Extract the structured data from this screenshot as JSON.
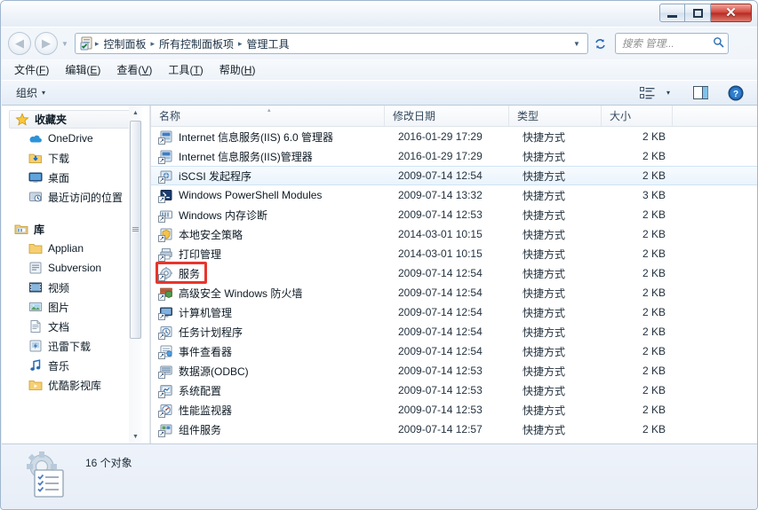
{
  "window": {
    "caption_buttons": [
      {
        "name": "minimize",
        "glyph": "minimize-icon"
      },
      {
        "name": "maximize",
        "glyph": "maximize-icon"
      },
      {
        "name": "close",
        "glyph": "close-icon",
        "label": "✕",
        "color": "#c5372c"
      }
    ]
  },
  "addressbar": {
    "back_label": "◀",
    "forward_label": "▶",
    "history_caret": "▼",
    "icon": "control-panel-icon",
    "crumbs": [
      "控制面板",
      "所有控制面板项",
      "管理工具"
    ],
    "separator": "▸",
    "dropdown_caret": "▼",
    "refresh_label": "↻"
  },
  "search": {
    "placeholder": "搜索 管理...",
    "icon_label": "⌕"
  },
  "menubar": {
    "items": [
      {
        "text": "文件",
        "key": "F"
      },
      {
        "text": "编辑",
        "key": "E"
      },
      {
        "text": "查看",
        "key": "V"
      },
      {
        "text": "工具",
        "key": "T"
      },
      {
        "text": "帮助",
        "key": "H"
      }
    ]
  },
  "commandbar": {
    "organize_label": "组织",
    "organize_caret": "▾",
    "view_icon": "view-options-icon",
    "view_caret": "▾",
    "preview_icon": "preview-pane-icon",
    "help_icon": "help-icon",
    "help_label": "?"
  },
  "sidebar": {
    "groups": [
      {
        "header": {
          "label": "收藏夹",
          "icon": "star-icon",
          "selected": true
        },
        "items": [
          {
            "label": "OneDrive",
            "icon": "onedrive-icon"
          },
          {
            "label": "下载",
            "icon": "downloads-icon"
          },
          {
            "label": "桌面",
            "icon": "desktop-icon"
          },
          {
            "label": "最近访问的位置",
            "icon": "recent-places-icon"
          }
        ]
      },
      {
        "header": {
          "label": "库",
          "icon": "library-icon",
          "selected": false
        },
        "items": [
          {
            "label": "Applian",
            "icon": "folder-icon"
          },
          {
            "label": "Subversion",
            "icon": "subversion-icon"
          },
          {
            "label": "视频",
            "icon": "videos-icon"
          },
          {
            "label": "图片",
            "icon": "pictures-icon"
          },
          {
            "label": "文档",
            "icon": "documents-icon"
          },
          {
            "label": "迅雷下载",
            "icon": "thunder-download-icon"
          },
          {
            "label": "音乐",
            "icon": "music-icon"
          },
          {
            "label": "优酷影视库",
            "icon": "youku-library-icon"
          }
        ]
      }
    ],
    "scrollbar": {
      "up_arrow": "▲",
      "down_arrow": "▼"
    }
  },
  "filelist": {
    "columns": [
      {
        "label": "名称",
        "sorted": true,
        "sort_glyph": "▴"
      },
      {
        "label": "修改日期"
      },
      {
        "label": "类型"
      },
      {
        "label": "大小"
      }
    ],
    "rows": [
      {
        "name": "Internet 信息服务(IIS) 6.0 管理器",
        "date": "2016-01-29 17:29",
        "type": "快捷方式",
        "size": "2 KB",
        "icon": "iis6-manager-icon",
        "selected": false,
        "highlighted": false
      },
      {
        "name": "Internet 信息服务(IIS)管理器",
        "date": "2016-01-29 17:29",
        "type": "快捷方式",
        "size": "2 KB",
        "icon": "iis-manager-icon",
        "selected": false,
        "highlighted": false
      },
      {
        "name": "iSCSI 发起程序",
        "date": "2009-07-14 12:54",
        "type": "快捷方式",
        "size": "2 KB",
        "icon": "iscsi-initiator-icon",
        "selected": true,
        "highlighted": false
      },
      {
        "name": "Windows PowerShell Modules",
        "date": "2009-07-14 13:32",
        "type": "快捷方式",
        "size": "3 KB",
        "icon": "powershell-modules-icon",
        "selected": false,
        "highlighted": false
      },
      {
        "name": "Windows 内存诊断",
        "date": "2009-07-14 12:53",
        "type": "快捷方式",
        "size": "2 KB",
        "icon": "memory-diagnostic-icon",
        "selected": false,
        "highlighted": false
      },
      {
        "name": "本地安全策略",
        "date": "2014-03-01 10:15",
        "type": "快捷方式",
        "size": "2 KB",
        "icon": "local-security-policy-icon",
        "selected": false,
        "highlighted": false
      },
      {
        "name": "打印管理",
        "date": "2014-03-01 10:15",
        "type": "快捷方式",
        "size": "2 KB",
        "icon": "print-management-icon",
        "selected": false,
        "highlighted": false
      },
      {
        "name": "服务",
        "date": "2009-07-14 12:54",
        "type": "快捷方式",
        "size": "2 KB",
        "icon": "services-icon",
        "selected": false,
        "highlighted": true
      },
      {
        "name": "高级安全 Windows 防火墙",
        "date": "2009-07-14 12:54",
        "type": "快捷方式",
        "size": "2 KB",
        "icon": "firewall-advanced-icon",
        "selected": false,
        "highlighted": false
      },
      {
        "name": "计算机管理",
        "date": "2009-07-14 12:54",
        "type": "快捷方式",
        "size": "2 KB",
        "icon": "computer-management-icon",
        "selected": false,
        "highlighted": false
      },
      {
        "name": "任务计划程序",
        "date": "2009-07-14 12:54",
        "type": "快捷方式",
        "size": "2 KB",
        "icon": "task-scheduler-icon",
        "selected": false,
        "highlighted": false
      },
      {
        "name": "事件查看器",
        "date": "2009-07-14 12:54",
        "type": "快捷方式",
        "size": "2 KB",
        "icon": "event-viewer-icon",
        "selected": false,
        "highlighted": false
      },
      {
        "name": "数据源(ODBC)",
        "date": "2009-07-14 12:53",
        "type": "快捷方式",
        "size": "2 KB",
        "icon": "odbc-icon",
        "selected": false,
        "highlighted": false
      },
      {
        "name": "系统配置",
        "date": "2009-07-14 12:53",
        "type": "快捷方式",
        "size": "2 KB",
        "icon": "system-configuration-icon",
        "selected": false,
        "highlighted": false
      },
      {
        "name": "性能监视器",
        "date": "2009-07-14 12:53",
        "type": "快捷方式",
        "size": "2 KB",
        "icon": "performance-monitor-icon",
        "selected": false,
        "highlighted": false
      },
      {
        "name": "组件服务",
        "date": "2009-07-14 12:57",
        "type": "快捷方式",
        "size": "2 KB",
        "icon": "component-services-icon",
        "selected": false,
        "highlighted": false
      }
    ]
  },
  "statusbar": {
    "text": "16 个对象",
    "icon": "admin-tools-folder-icon"
  },
  "colors": {
    "highlight_box": "#e8352b",
    "selection": "#eaf4fc",
    "close_button": "#c5372c",
    "accent": "#2a6ab5"
  }
}
